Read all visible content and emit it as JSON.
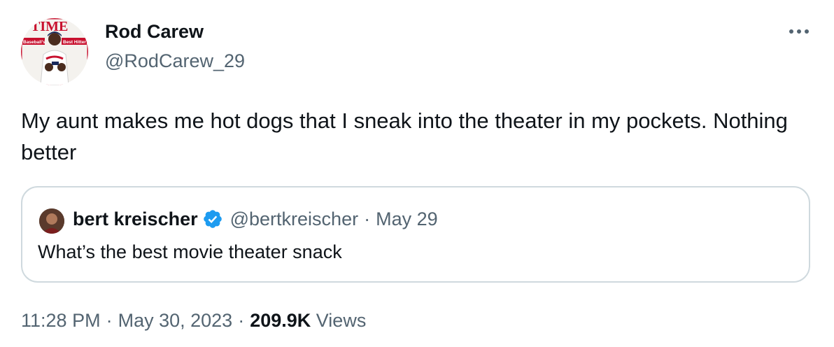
{
  "author": {
    "display_name": "Rod Carew",
    "handle": "@RodCarew_29",
    "avatar_text": {
      "magazine": "TIME",
      "left": "Baseball's",
      "right": "Best Hitter"
    }
  },
  "tweet": {
    "text": "My aunt makes me hot dogs that I sneak into the theater in my pockets. Nothing better"
  },
  "quoted_tweet": {
    "display_name": "bert kreischer",
    "handle": "@bertkreischer",
    "separator": "·",
    "date": "May 29",
    "text": "What’s the best movie theater snack"
  },
  "meta": {
    "time": "11:28 PM",
    "separator": "·",
    "date": "May 30, 2023",
    "views_count": "209.9K",
    "views_label": "Views"
  },
  "icons": {
    "more": "more-horizontal-icon",
    "verified": "verified-badge-icon"
  },
  "colors": {
    "text_primary": "#0f1419",
    "text_secondary": "#536471",
    "border": "#cfd9de",
    "verified": "#1d9bf0"
  }
}
